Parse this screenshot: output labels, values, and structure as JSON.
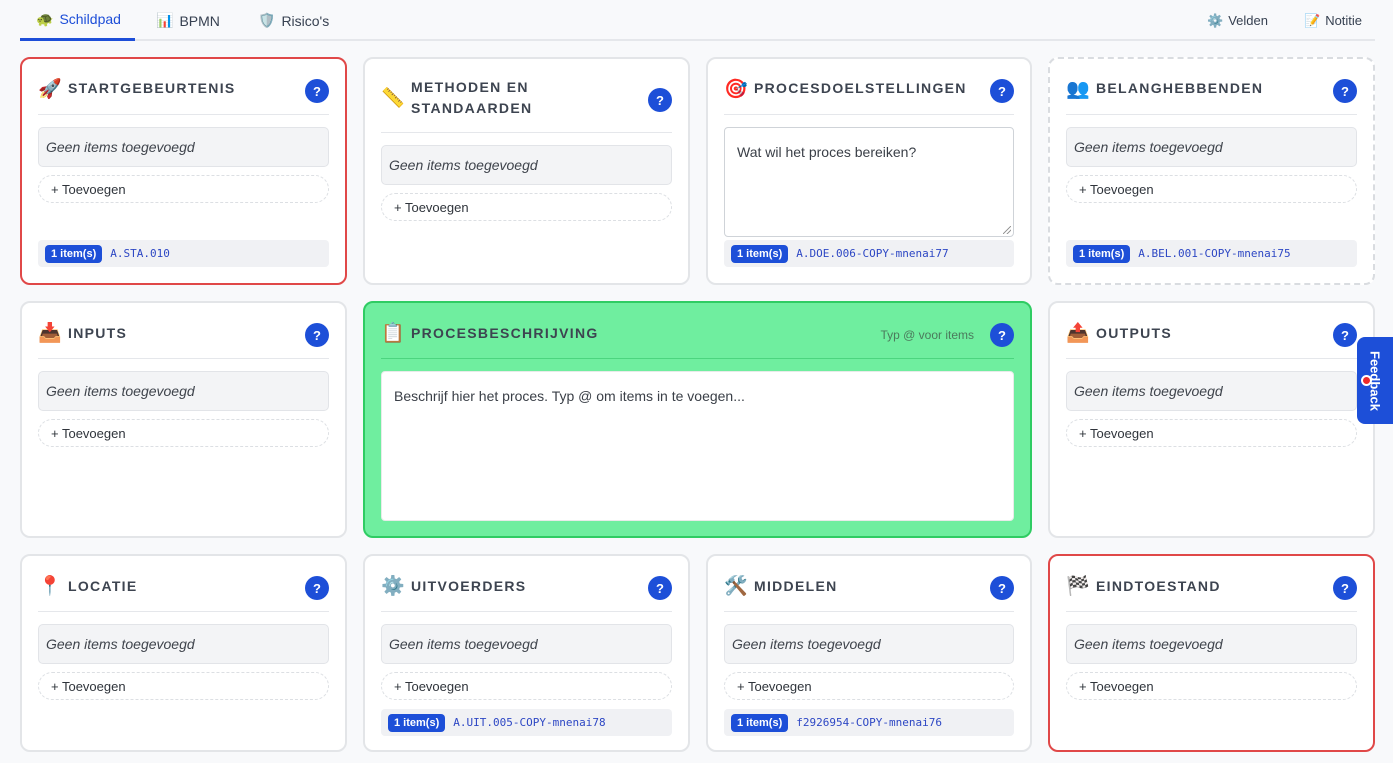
{
  "tabs": [
    {
      "label": "Schildpad",
      "icon": "🐢"
    },
    {
      "label": "BPMN",
      "icon": "📊"
    },
    {
      "label": "Risico's",
      "icon": "🛡️"
    }
  ],
  "right_tabs": [
    {
      "label": "Velden",
      "icon": "⚙️"
    },
    {
      "label": "Notitie",
      "icon": "📝"
    }
  ],
  "common": {
    "empty": "Geen items toegevoegd",
    "add": "+ Toevoegen",
    "help": "?"
  },
  "cards": {
    "startgebeurtenis": {
      "title": "STARTGEBEURTENIS",
      "icon": "🚀",
      "badge": "1 item(s)",
      "code": "A.STA.010"
    },
    "methoden": {
      "title_line1": "METHODEN EN",
      "title_line2": "STANDAARDEN",
      "icon": "📏"
    },
    "procesdoelstellingen": {
      "title": "PROCESDOELSTELLINGEN",
      "icon": "🎯",
      "placeholder": "Wat wil het proces bereiken?",
      "badge": "1 item(s)",
      "code": "A.DOE.006-COPY-mnenai77"
    },
    "belanghebbenden": {
      "title": "BELANGHEBBENDEN",
      "icon": "👥",
      "badge": "1 item(s)",
      "code": "A.BEL.001-COPY-mnenai75"
    },
    "inputs": {
      "title": "INPUTS",
      "icon": "📥"
    },
    "procesbeschrijving": {
      "title": "PROCESBESCHRIJVING",
      "icon": "📋",
      "hint": "Typ @ voor items",
      "placeholder": "Beschrijf hier het proces. Typ @ om items in te voegen..."
    },
    "outputs": {
      "title": "OUTPUTS",
      "icon": "📤"
    },
    "locatie": {
      "title": "LOCATIE",
      "icon": "📍"
    },
    "uitvoerders": {
      "title": "UITVOERDERS",
      "icon": "⚙️",
      "badge": "1 item(s)",
      "code": "A.UIT.005-COPY-mnenai78"
    },
    "middelen": {
      "title": "MIDDELEN",
      "icon": "🛠️",
      "badge": "1 item(s)",
      "code": "f2926954-COPY-mnenai76"
    },
    "eindtoestand": {
      "title": "EINDTOESTAND",
      "icon": "🏁"
    }
  },
  "feedback": {
    "label": "Feedback"
  },
  "colors": {
    "accent": "#1d4fd8",
    "danger": "#e04848",
    "success": "#6fee9f"
  }
}
